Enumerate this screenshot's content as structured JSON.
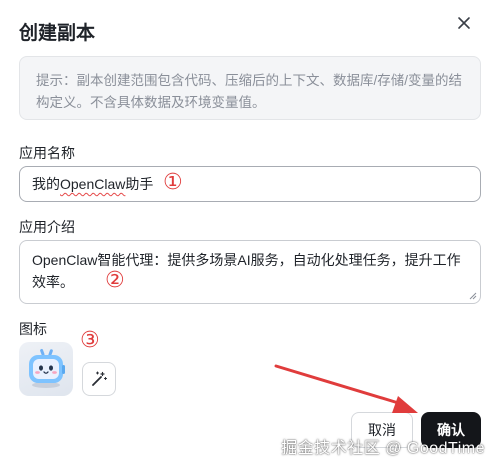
{
  "dialog": {
    "title": "创建副本",
    "close_icon": "close-icon",
    "hint": "提示：副本创建范围包含代码、压缩后的上下文、数据库/存储/变量的结构定义。不含具体数据及环境变量值。"
  },
  "fields": {
    "name_label": "应用名称",
    "name_value_prefix": "我的",
    "name_value_brand": "OpenClaw",
    "name_value_suffix": "助手",
    "intro_label": "应用介绍",
    "intro_value": "OpenClaw智能代理：提供多场景AI服务，自动化处理任务，提升工作效率。",
    "icon_label": "图标"
  },
  "annotations": {
    "marker_1": "①",
    "marker_2": "②",
    "marker_3": "③"
  },
  "icons": {
    "app_icon": "robot-tv-avatar-icon",
    "magic_icon": "magic-wand-icon"
  },
  "buttons": {
    "cancel": "取消",
    "confirm": "确认"
  },
  "watermark": "掘金技术社区 @ GoodTime",
  "colors": {
    "annotation_red": "#e03c3c",
    "confirm_bg": "#14161a",
    "hint_bg": "#f4f5f7"
  }
}
